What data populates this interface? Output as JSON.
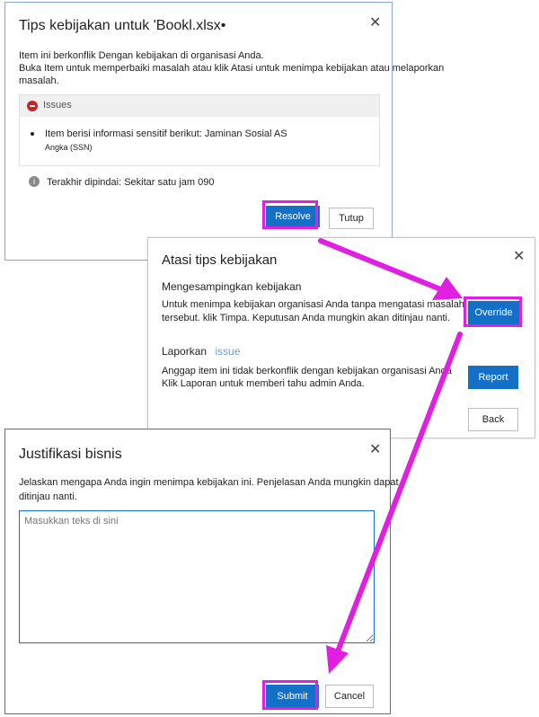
{
  "policy_tips": {
    "title": "Tips kebijakan untuk 'Bookl.xlsx•",
    "message_line1": "Item ini berkonflik Dengan kebijakan di organisasi Anda.",
    "message_line2": "Buka Item untuk memperbaiki masalah atau klik Atasi untuk menimpa kebijakan atau melaporkan",
    "message_line3": "masalah.",
    "issues_header": "Issues",
    "issue_item_line1": "Item berisi informasi sensitif berikut: Jaminan Sosial AS",
    "issue_item_line2": "Angka (SSN)",
    "last_scanned": "Terakhir dipindai: Sekitar satu jam 090",
    "resolve_label": "Resolve",
    "close_label": "Tutup"
  },
  "resolve_tips": {
    "title": "Atasi tips kebijakan",
    "override_heading": "Mengesampingkan kebijakan",
    "override_line1": "Untuk menimpa kebijakan organisasi Anda tanpa mengatasi masalah",
    "override_line2": "tersebut. klik Timpa. Keputusan Anda mungkin akan ditinjau nanti.",
    "override_label": "Override",
    "report_heading": "Laporkan",
    "report_heading_suffix": "issue",
    "report_line1": "Anggap item ini tidak berkonflik dengan kebijakan organisasi Anda",
    "report_line2": "Klik Laporan untuk memberi tahu admin Anda.",
    "report_label": "Report",
    "back_label": "Back"
  },
  "justification": {
    "title": "Justifikasi bisnis",
    "desc_line1": "Jelaskan mengapa Anda ingin menimpa kebijakan ini. Penjelasan Anda mungkin dapat",
    "desc_line2": "ditinjau nanti.",
    "placeholder": "Masukkan teks di sini",
    "submit_label": "Submit",
    "cancel_label": "Cancel"
  },
  "colors": {
    "accent": "#1470c7",
    "highlight": "#e01fe0",
    "error_icon": "#c0272d",
    "info_icon": "#8a8a8a"
  },
  "icons": {
    "close": "close-icon",
    "issues": "error-circle-icon",
    "info": "info-icon",
    "bullet": "bullet-icon"
  }
}
